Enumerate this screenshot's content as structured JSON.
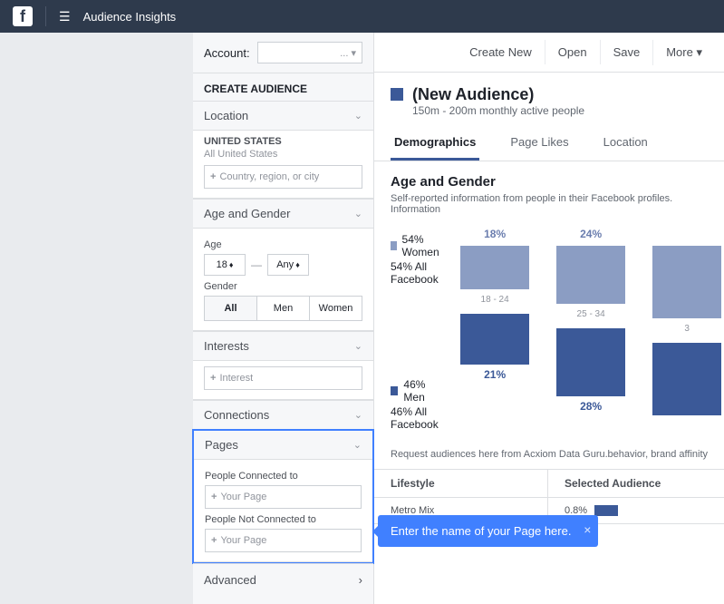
{
  "topbar": {
    "title": "Audience Insights"
  },
  "account": {
    "label": "Account:",
    "display": "... ▾"
  },
  "toolbar": {
    "create": "Create New",
    "open": "Open",
    "save": "Save",
    "more": "More"
  },
  "create_heading": "CREATE AUDIENCE",
  "sections": {
    "location": "Location",
    "age_gender": "Age and Gender",
    "interests": "Interests",
    "connections": "Connections",
    "pages": "Pages",
    "advanced": "Advanced"
  },
  "location_panel": {
    "title": "UNITED STATES",
    "meta": "All United States",
    "placeholder": "Country, region, or city"
  },
  "age_panel": {
    "age_label": "Age",
    "min": "18",
    "max": "Any",
    "gender_label": "Gender",
    "genders": [
      "All",
      "Men",
      "Women"
    ]
  },
  "interests_panel": {
    "placeholder": "Interest"
  },
  "pages_panel": {
    "connected": "People Connected to",
    "not_connected": "People Not Connected to",
    "placeholder": "Your Page"
  },
  "audience": {
    "title": "(New Audience)",
    "meta": "150m - 200m monthly active people"
  },
  "tabs": [
    "Demographics",
    "Page Likes",
    "Location"
  ],
  "age_gender_section": {
    "title": "Age and Gender",
    "desc": "Self-reported information from people in their Facebook profiles. Information",
    "women_pct": "54% Women",
    "women_sub": "54% All Facebook",
    "men_pct": "46% Men",
    "men_sub": "46% All Facebook"
  },
  "chart_data": {
    "type": "bar",
    "categories": [
      "18 - 24",
      "25 - 34",
      "3"
    ],
    "series": [
      {
        "name": "Women",
        "values": [
          18,
          24,
          null
        ],
        "color": "#8b9dc3"
      },
      {
        "name": "Men",
        "values": [
          21,
          28,
          null
        ],
        "color": "#3b5998"
      }
    ],
    "ylabel": "%"
  },
  "callout": {
    "text": "Enter the name of your Page here."
  },
  "below_note": "behavior, brand affinity",
  "request_note": "Request audiences here from Acxiom Data Guru.",
  "table": {
    "headers": [
      "Lifestyle",
      "Selected Audience"
    ],
    "rows": [
      {
        "label": "Metro Mix",
        "value": "0.8%"
      }
    ]
  }
}
